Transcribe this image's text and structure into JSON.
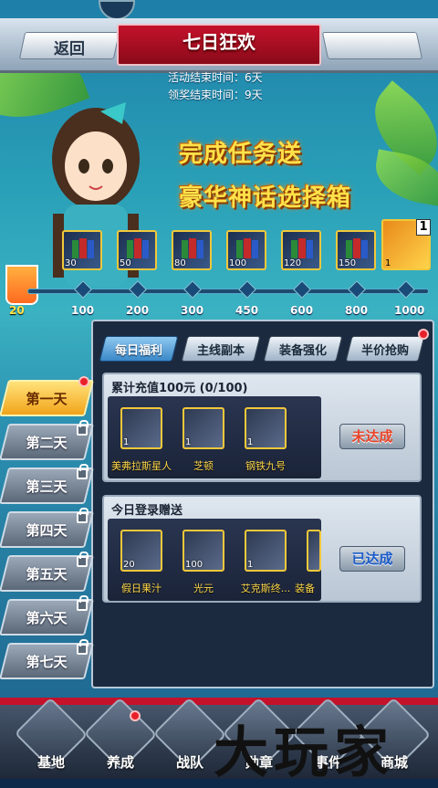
{
  "header": {
    "title": "七日狂欢",
    "back_label": "返回"
  },
  "event_info": {
    "activity_end": "活动结束时间：6天",
    "reward_end": "领奖结束时间：9天"
  },
  "promo": {
    "line1": "完成任务送",
    "line2": "豪华神话选择箱"
  },
  "progress": {
    "current": "20",
    "milestones": [
      "100",
      "200",
      "300",
      "450",
      "600",
      "800",
      "1000"
    ],
    "reward_counts": [
      "30",
      "50",
      "80",
      "100",
      "120",
      "150"
    ],
    "big_reward_badge": "1",
    "big_reward_count": "1"
  },
  "tabs": [
    "每日福利",
    "主线副本",
    "装备强化",
    "半价抢购"
  ],
  "days": [
    "第一天",
    "第二天",
    "第三天",
    "第四天",
    "第五天",
    "第六天",
    "第七天"
  ],
  "cards": [
    {
      "title": "累计充值100元 (0/100)",
      "status": "未达成",
      "items": [
        {
          "name": "美弗拉斯星人",
          "count": "1"
        },
        {
          "name": "芝顿",
          "count": "1"
        },
        {
          "name": "钢铁九号",
          "count": "1"
        }
      ]
    },
    {
      "title": "今日登录赠送",
      "status": "已达成",
      "items": [
        {
          "name": "假日果汁",
          "count": "20"
        },
        {
          "name": "光元",
          "count": "100"
        },
        {
          "name": "艾克斯终...",
          "count": "1"
        },
        {
          "name": "装备",
          "count": ""
        }
      ]
    }
  ],
  "bottom_nav": [
    "基地",
    "养成",
    "战队",
    "勋章",
    "事件",
    "商城"
  ],
  "watermark": "大玩家",
  "colors": {
    "title_red": "#c4122a",
    "promo_yellow": "#ffe24a",
    "active_tab": "#3a88c8",
    "status_red": "#e8442a",
    "status_blue": "#1a5ac8"
  }
}
